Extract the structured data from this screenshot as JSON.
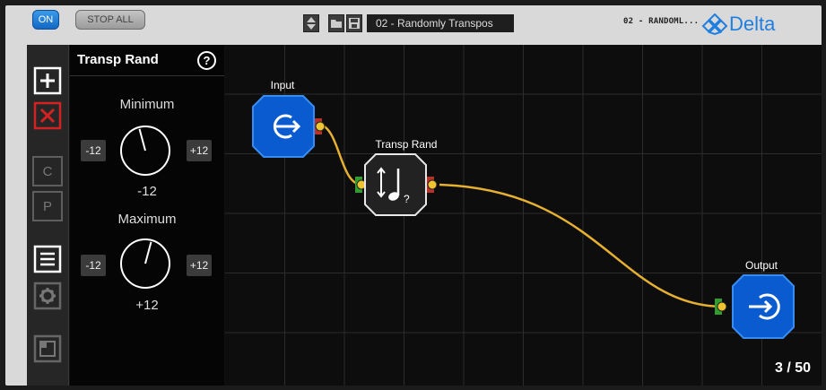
{
  "topbar": {
    "on_label": "ON",
    "stop_all_label": "STOP ALL",
    "preset_name": "02 - Randomly Transpos",
    "preset_thumb_label": "02 - RANDOML...",
    "logo_text": "Delta"
  },
  "toolbar": {
    "copy_label": "C",
    "paste_label": "P"
  },
  "inspector": {
    "title": "Transp Rand",
    "help_label": "?",
    "minimum": {
      "label": "Minimum",
      "low": "-12",
      "high": "+12",
      "value": "-12",
      "fraction": 0.0
    },
    "maximum": {
      "label": "Maximum",
      "low": "-12",
      "high": "+12",
      "value": "+12",
      "fraction": 1.0
    }
  },
  "graph": {
    "nodes": [
      {
        "id": "input",
        "label": "Input",
        "icon": "input-arrow-icon"
      },
      {
        "id": "transp-rand",
        "label": "Transp Rand",
        "icon": "transpose-random-icon"
      },
      {
        "id": "output",
        "label": "Output",
        "icon": "output-arrow-icon"
      }
    ],
    "counter": "3 / 50"
  },
  "colors": {
    "accent_blue": "#1468c4",
    "node_blue": "#0b5bd0",
    "cable": "#e6b030",
    "port_in": "#2f9e2f",
    "port_out": "#b8322a",
    "delete_red": "#d22222"
  }
}
